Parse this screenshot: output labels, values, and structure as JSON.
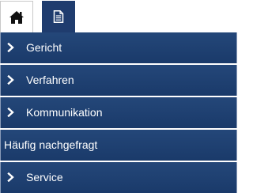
{
  "tabs": [
    {
      "icon": "home-icon",
      "active": false
    },
    {
      "icon": "document-icon",
      "active": true
    }
  ],
  "menu": {
    "items": [
      {
        "label": "Gericht",
        "has_chevron": true
      },
      {
        "label": "Verfahren",
        "has_chevron": true
      },
      {
        "label": "Kommunikation",
        "has_chevron": true
      },
      {
        "label": "Häufig nachgefragt",
        "has_chevron": false
      },
      {
        "label": "Service",
        "has_chevron": true
      }
    ]
  },
  "colors": {
    "menu_bg": "#1f3c6e",
    "menu_text": "#ffffff",
    "separator": "#ffffff"
  }
}
